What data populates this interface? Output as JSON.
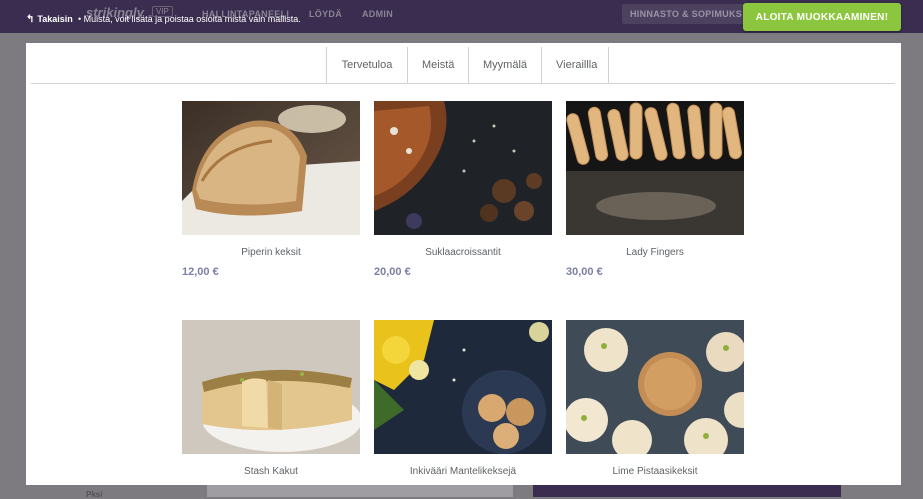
{
  "topbar": {
    "back_label": "Takaisin",
    "notice": "•  Muista, voit lisätä ja poistaa osioita mistä vain mallista.",
    "logo": "strikingly",
    "logo_badge": "VIP",
    "nav": [
      "HALLINTAPANEELI",
      "LÖYDÄ",
      "ADMIN"
    ],
    "pricing_label": "HINNASTO & SOPIMUKS",
    "start_label": "ALOITA MUOKKAAMINEN!"
  },
  "menu": {
    "tabs": [
      {
        "label": "Tervetuloa"
      },
      {
        "label": "Meistä"
      },
      {
        "label": "Myymälä"
      },
      {
        "label": "Vieraillla"
      }
    ]
  },
  "products": [
    {
      "name": "Piperin keksit",
      "price": "12,00 €",
      "image": "bread-loaf-photo"
    },
    {
      "name": "Suklaacroissantit",
      "price": "20,00 €",
      "image": "croissant-photo"
    },
    {
      "name": "Lady Fingers",
      "price": "30,00 €",
      "image": "lady-fingers-photo"
    },
    {
      "name": "Stash Kakut",
      "price": "",
      "image": "tart-photo"
    },
    {
      "name": "Inkivääri Mantelikeksejä",
      "price": "",
      "image": "almond-cookies-photo"
    },
    {
      "name": "Lime Pistaasikeksit",
      "price": "",
      "image": "pistachio-cookies-photo"
    }
  ],
  "colors": {
    "accent_green": "#8cc63e",
    "topbar_purple": "#3a2d4f",
    "price_color": "#7b7fa6"
  },
  "bottom": {
    "label": "Pksi"
  }
}
